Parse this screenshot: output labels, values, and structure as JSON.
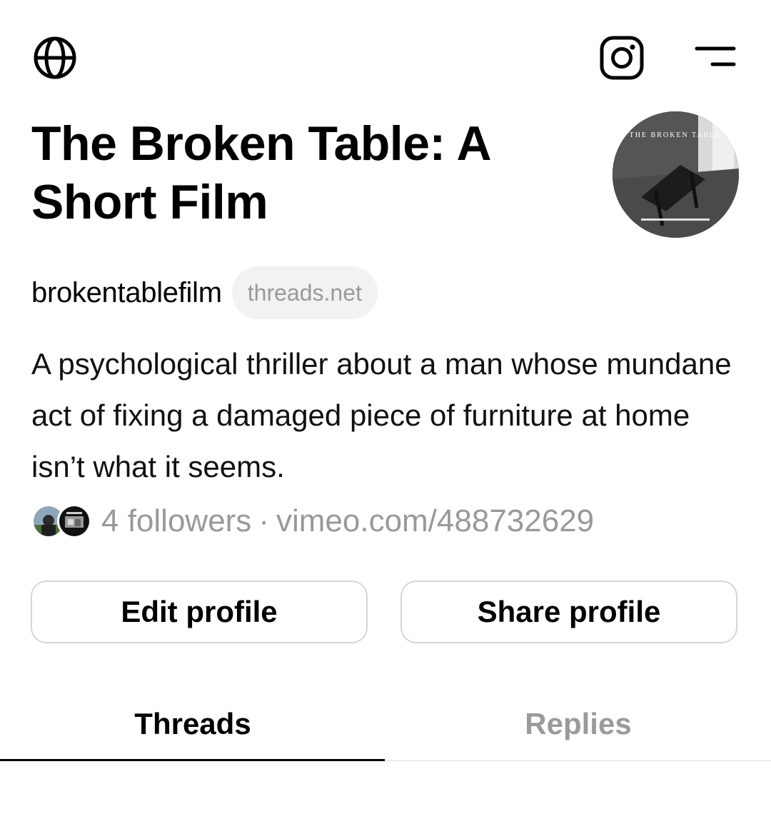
{
  "header": {
    "globe_icon": "globe-icon",
    "instagram_icon": "instagram-icon",
    "menu_icon": "menu-icon"
  },
  "profile": {
    "name": "The Broken Table: A Short Film",
    "handle": "brokentablefilm",
    "domain_badge": "threads.net",
    "bio": "A psychological thriller about a man whose mundane act of fixing a damaged piece of furniture at home isn’t what it seems.",
    "followers": "4 followers",
    "separator": "·",
    "link": "vimeo.com/488732629",
    "avatar_title_text": "THE BROKEN TABLE"
  },
  "actions": {
    "edit_label": "Edit profile",
    "share_label": "Share profile"
  },
  "tabs": [
    {
      "label": "Threads",
      "active": true
    },
    {
      "label": "Replies",
      "active": false
    }
  ],
  "colors": {
    "text": "#000000",
    "muted": "#999999",
    "pill_bg": "#f2f2f2",
    "border": "#d6d6d6"
  }
}
